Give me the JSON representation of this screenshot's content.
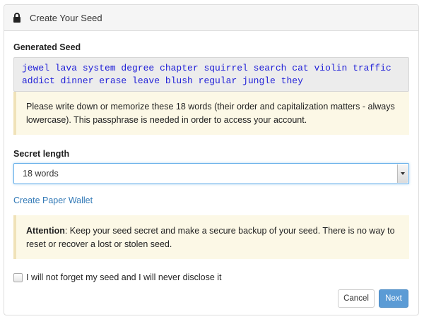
{
  "dialog": {
    "title": "Create Your Seed",
    "title_icon": "lock-icon"
  },
  "seed": {
    "label": "Generated Seed",
    "phrase": "jewel lava system degree chapter squirrel search cat violin traffic addict dinner erase leave blush regular jungle they"
  },
  "notice": {
    "text": "Please write down or memorize these 18 words (their order and capitalization matters - always lowercase). This passphrase is needed in order to access your account."
  },
  "secret_length": {
    "label": "Secret length",
    "selected": "18 words"
  },
  "paper_wallet_link": "Create Paper Wallet",
  "attention": {
    "bold": "Attention",
    "text": ": Keep your seed secret and make a secure backup of your seed. There is no way to reset or recover a lost or stolen seed."
  },
  "confirm": {
    "label": "I will not forget my seed and I will never disclose it",
    "checked": false
  },
  "buttons": {
    "cancel": "Cancel",
    "next": "Next"
  },
  "colors": {
    "seed_text": "#2020d8",
    "notice_bg": "#fcf8e6",
    "link": "#337ab7",
    "primary_button": "#5b9bd5"
  }
}
